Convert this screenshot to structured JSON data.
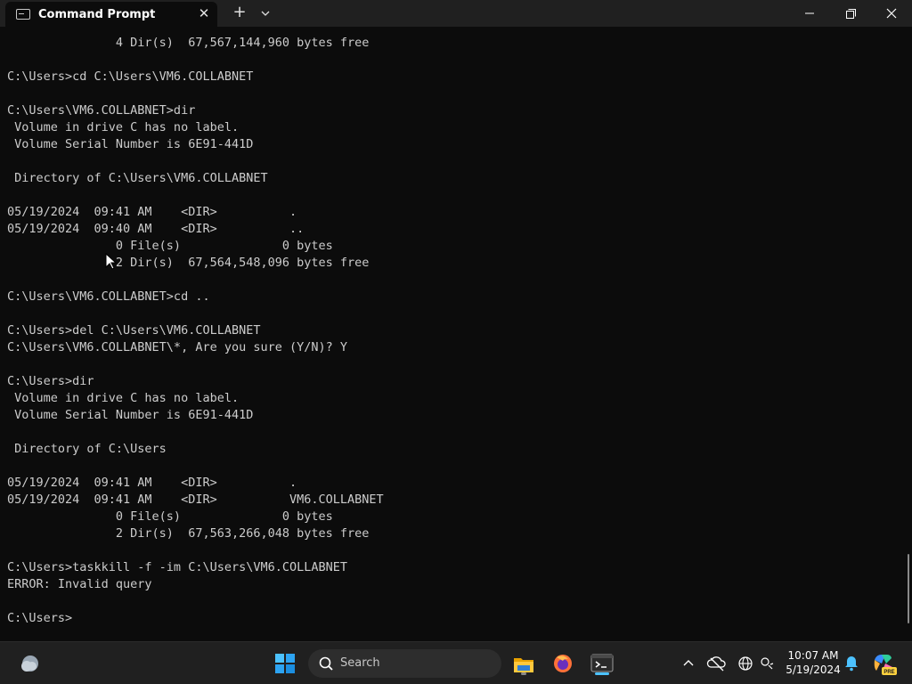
{
  "window": {
    "tab_title": "Command Prompt",
    "tab_close": "✕",
    "new_tab": "+"
  },
  "terminal": {
    "lines": [
      "               4 Dir(s)  67,567,144,960 bytes free",
      "",
      "C:\\Users>cd C:\\Users\\VM6.COLLABNET",
      "",
      "C:\\Users\\VM6.COLLABNET>dir",
      " Volume in drive C has no label.",
      " Volume Serial Number is 6E91-441D",
      "",
      " Directory of C:\\Users\\VM6.COLLABNET",
      "",
      "05/19/2024  09:41 AM    <DIR>          .",
      "05/19/2024  09:40 AM    <DIR>          ..",
      "               0 File(s)              0 bytes",
      "               2 Dir(s)  67,564,548,096 bytes free",
      "",
      "C:\\Users\\VM6.COLLABNET>cd ..",
      "",
      "C:\\Users>del C:\\Users\\VM6.COLLABNET",
      "C:\\Users\\VM6.COLLABNET\\*, Are you sure (Y/N)? Y",
      "",
      "C:\\Users>dir",
      " Volume in drive C has no label.",
      " Volume Serial Number is 6E91-441D",
      "",
      " Directory of C:\\Users",
      "",
      "05/19/2024  09:41 AM    <DIR>          .",
      "05/19/2024  09:41 AM    <DIR>          VM6.COLLABNET",
      "               0 File(s)              0 bytes",
      "               2 Dir(s)  67,563,266,048 bytes free",
      "",
      "C:\\Users>taskkill -f -im C:\\Users\\VM6.COLLABNET",
      "ERROR: Invalid query",
      "",
      "C:\\Users>"
    ]
  },
  "taskbar": {
    "search_placeholder": "Search",
    "clock_time": "10:07 AM",
    "clock_date": "5/19/2024",
    "copilot_badge": "PRE",
    "icons": [
      "weather-icon",
      "start-icon",
      "search-icon",
      "file-explorer-icon",
      "firefox-icon",
      "terminal-icon",
      "chevron-up-icon",
      "onedrive-icon",
      "network-icon",
      "accessibility-icon",
      "notification-bell-icon",
      "copilot-icon"
    ]
  },
  "colors": {
    "terminal_bg": "#0c0c0c",
    "terminal_text": "#cccccc",
    "titlebar_bg": "#202020",
    "taskbar_bg": "#202020",
    "accent": "#4cc2ff"
  }
}
